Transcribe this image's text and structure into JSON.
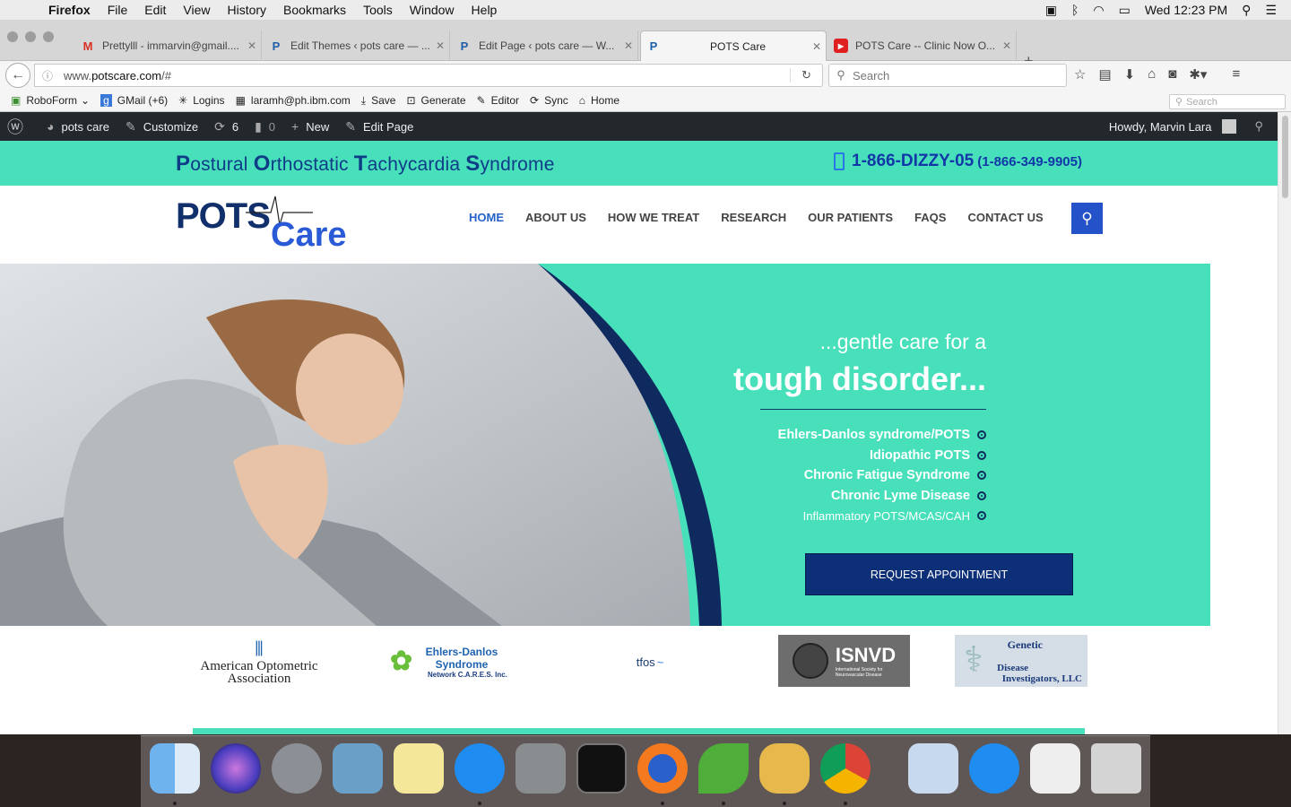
{
  "macos": {
    "menu": [
      "Firefox",
      "File",
      "Edit",
      "View",
      "History",
      "Bookmarks",
      "Tools",
      "Window",
      "Help"
    ],
    "clock": "Wed 12:23 PM"
  },
  "tabs": [
    {
      "label": "Prettylll - immarvin@gmail....",
      "favicon": "M"
    },
    {
      "label": "Edit Themes ‹ pots care — ...",
      "favicon": "P"
    },
    {
      "label": "Edit Page ‹ pots care — W...",
      "favicon": "P"
    },
    {
      "label": "POTS Care",
      "favicon": "P"
    },
    {
      "label": "POTS Care -- Clinic Now O...",
      "favicon": "▶"
    }
  ],
  "url": {
    "prefix": "www.",
    "domain": "potscare.com",
    "suffix": "/#"
  },
  "search_placeholder": "Search",
  "bookmarks": [
    "RoboForm",
    "GMail (+6)",
    "Logins",
    "laramh@ph.ibm.com",
    "Save",
    "Generate",
    "Editor",
    "Sync",
    "Home"
  ],
  "bookmarks_search": "Search",
  "wp_admin": {
    "site": "pots care",
    "customize": "Customize",
    "updates": "6",
    "comments": "0",
    "new": "New",
    "edit": "Edit Page",
    "howdy": "Howdy, Marvin Lara"
  },
  "site": {
    "tagline_parts": [
      {
        "cap": "P",
        "rest": "ostural "
      },
      {
        "cap": "O",
        "rest": "rthostatic "
      },
      {
        "cap": "T",
        "rest": "achycardia "
      },
      {
        "cap": "S",
        "rest": "yndrome"
      }
    ],
    "phone": "1-866-DIZZY-05",
    "phone_numeric": "(1-866-349-9905)",
    "logo_top": "POTS",
    "logo_bottom": "Care",
    "nav": [
      "HOME",
      "ABOUT US",
      "HOW WE TREAT",
      "RESEARCH",
      "OUR PATIENTS",
      "FAQS",
      "CONTACT US"
    ],
    "hero_line1": "...gentle care for a",
    "hero_line2": "tough disorder...",
    "conditions": [
      "Ehlers-Danlos syndrome/POTS",
      "Idiopathic POTS",
      "Chronic Fatigue Syndrome",
      "Chronic Lyme Disease",
      "Inflammatory POTS/MCAS/CAH"
    ],
    "cta": "REQUEST APPOINTMENT",
    "partners": [
      {
        "line1": "American Optometric",
        "line2": "Association"
      },
      {
        "line1": "Ehlers-Danlos Syndrome",
        "line2": "Network C.A.R.E.S. Inc."
      },
      {
        "line1": "tfos"
      },
      {
        "line1": "ISNVD",
        "line2": "International Society for Neurovascular Disease"
      },
      {
        "line1": "Genetic",
        "line2": "Disease",
        "line3": "Investigators, LLC"
      }
    ]
  },
  "colors": {
    "teal": "#47e0bb",
    "navy": "#0d2f77",
    "blue": "#2563c9",
    "wpbar": "#23282d"
  }
}
